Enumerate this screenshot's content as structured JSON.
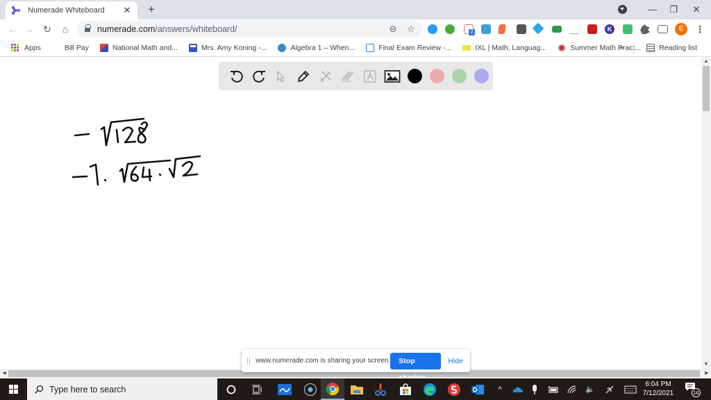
{
  "browser": {
    "tab": {
      "title": "Numerade Whiteboard",
      "close_glyph": "✕"
    },
    "new_tab_glyph": "+",
    "window_controls": {
      "minimize": "—",
      "restore": "❐",
      "close": "✕"
    },
    "nav": {
      "back": "←",
      "forward": "→",
      "reload": "↻",
      "home": "⌂"
    },
    "omnibox": {
      "host": "numerade.com",
      "path": "/answers/whiteboard/",
      "zoom_glyph": "⊖",
      "star_glyph": "☆"
    },
    "extension_badge": "2",
    "profile_initial": "E",
    "menu_glyph": "⋮",
    "bookmarks": [
      {
        "label": "Apps",
        "icon": "apps-grid-icon"
      },
      {
        "label": "Bill Pay",
        "icon": "none"
      },
      {
        "label": "National Math and...",
        "icon": "national-math-icon"
      },
      {
        "label": "Mrs. Amy Koning -...",
        "icon": "google-sites-icon"
      },
      {
        "label": "Algebra 1 – When...",
        "icon": "wordpress-icon"
      },
      {
        "label": "Final Exam Review -...",
        "icon": "google-sites-icon"
      },
      {
        "label": "IXL | Math, Languag...",
        "icon": "ixl-icon"
      },
      {
        "label": "Summer Math Pract...",
        "icon": "summer-math-icon"
      }
    ],
    "bookmarks_overflow": "»",
    "reading_list": "Reading list"
  },
  "whiteboard": {
    "tools": [
      {
        "name": "undo",
        "enabled": true
      },
      {
        "name": "redo",
        "enabled": true
      },
      {
        "name": "select",
        "enabled": false
      },
      {
        "name": "pen",
        "enabled": true
      },
      {
        "name": "shapes",
        "enabled": false
      },
      {
        "name": "eraser",
        "enabled": false
      },
      {
        "name": "text",
        "enabled": false
      },
      {
        "name": "image",
        "enabled": true
      }
    ],
    "colors": [
      {
        "name": "black",
        "hex": "#000000",
        "selected": true
      },
      {
        "name": "pink",
        "hex": "#eeaaaa",
        "selected": false
      },
      {
        "name": "green",
        "hex": "#aad4aa",
        "selected": false
      },
      {
        "name": "lavender",
        "hex": "#aaaaee",
        "selected": false
      }
    ],
    "handwriting": [
      {
        "line": 1,
        "content": "−√128"
      },
      {
        "line": 2,
        "content": "−1·√64·√2"
      }
    ]
  },
  "sharing_bar": {
    "message": "www.numerade.com is sharing your screen.",
    "stop_label": "Stop sharing",
    "hide_label": "Hide"
  },
  "taskbar": {
    "search_placeholder": "Type here to search",
    "apps": [
      "cortana",
      "task-view",
      "whiteboard-app",
      "media-app",
      "chrome",
      "file-explorer",
      "snip-sketch",
      "store",
      "edge",
      "red-s-app",
      "outlook"
    ],
    "active_app": "chrome",
    "tray": {
      "chevron": "^",
      "volume": "🔈"
    },
    "time": "6:04 PM",
    "date": "7/12/2021",
    "notifications_count": "16"
  },
  "colors": {
    "accent_blue": "#1a73e8",
    "avatar_orange": "#f0730c",
    "tabstrip": "#dee1e6",
    "taskbar": "#1f1a17"
  }
}
